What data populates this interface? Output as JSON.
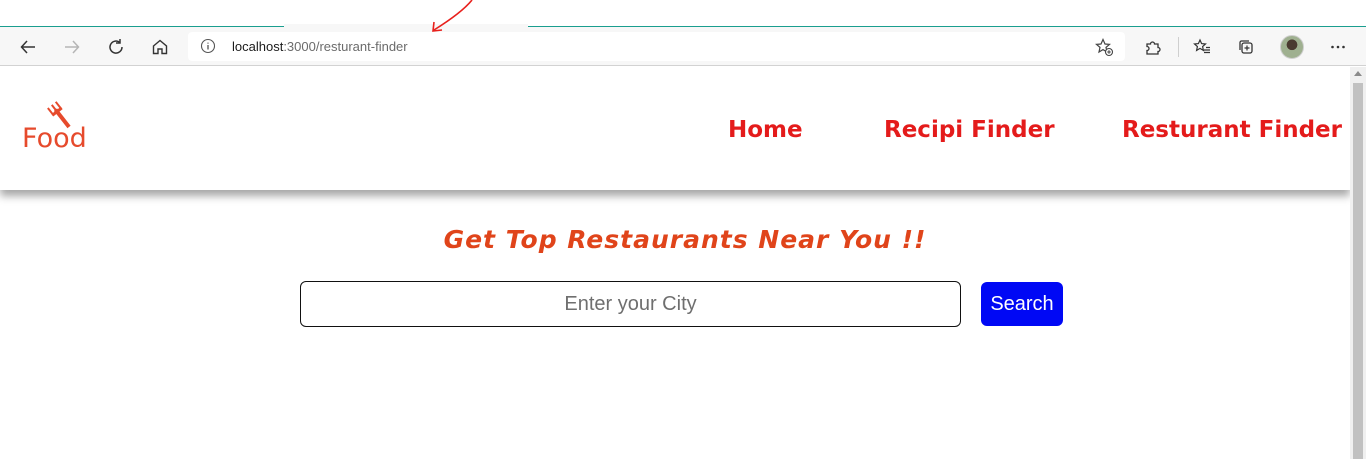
{
  "browser": {
    "address": {
      "host": "localhost",
      "path": ":3000/resturant-finder"
    }
  },
  "colors": {
    "nav_link": "#e41b1b",
    "headline": "#e0441a",
    "search_button": "#0008f5",
    "logo": "#e64a2c"
  },
  "site": {
    "logo_text": "Food",
    "nav": [
      {
        "label": "Home"
      },
      {
        "label": "Recipi Finder"
      },
      {
        "label": "Resturant Finder"
      }
    ]
  },
  "main": {
    "headline": "Get Top Restaurants Near You !!",
    "city_input": {
      "value": "",
      "placeholder": "Enter your City"
    },
    "search_label": "Search"
  }
}
